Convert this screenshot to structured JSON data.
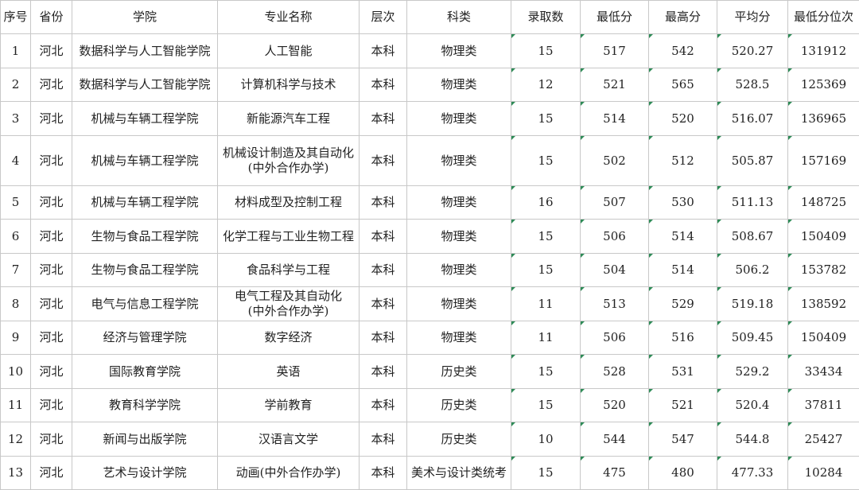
{
  "table": {
    "headers": [
      "序号",
      "省份",
      "学院",
      "专业名称",
      "层次",
      "科类",
      "录取数",
      "最低分",
      "最高分",
      "平均分",
      "最低分位次"
    ],
    "rows": [
      [
        "1",
        "河北",
        "数据科学与人工智能学院",
        "人工智能",
        "本科",
        "物理类",
        "15",
        "517",
        "542",
        "520.27",
        "131912"
      ],
      [
        "2",
        "河北",
        "数据科学与人工智能学院",
        "计算机科学与技术",
        "本科",
        "物理类",
        "12",
        "521",
        "565",
        "528.5",
        "125369"
      ],
      [
        "3",
        "河北",
        "机械与车辆工程学院",
        "新能源汽车工程",
        "本科",
        "物理类",
        "15",
        "514",
        "520",
        "516.07",
        "136965"
      ],
      [
        "4",
        "河北",
        "机械与车辆工程学院",
        "机械设计制造及其自动化\n(中外合作办学)",
        "本科",
        "物理类",
        "15",
        "502",
        "512",
        "505.87",
        "157169"
      ],
      [
        "5",
        "河北",
        "机械与车辆工程学院",
        "材料成型及控制工程",
        "本科",
        "物理类",
        "16",
        "507",
        "530",
        "511.13",
        "148725"
      ],
      [
        "6",
        "河北",
        "生物与食品工程学院",
        "化学工程与工业生物工程",
        "本科",
        "物理类",
        "15",
        "506",
        "514",
        "508.67",
        "150409"
      ],
      [
        "7",
        "河北",
        "生物与食品工程学院",
        "食品科学与工程",
        "本科",
        "物理类",
        "15",
        "504",
        "514",
        "506.2",
        "153782"
      ],
      [
        "8",
        "河北",
        "电气与信息工程学院",
        "电气工程及其自动化\n(中外合作办学)",
        "本科",
        "物理类",
        "11",
        "513",
        "529",
        "519.18",
        "138592"
      ],
      [
        "9",
        "河北",
        "经济与管理学院",
        "数字经济",
        "本科",
        "物理类",
        "11",
        "506",
        "516",
        "509.45",
        "150409"
      ],
      [
        "10",
        "河北",
        "国际教育学院",
        "英语",
        "本科",
        "历史类",
        "15",
        "528",
        "531",
        "529.2",
        "33434"
      ],
      [
        "11",
        "河北",
        "教育科学学院",
        "学前教育",
        "本科",
        "历史类",
        "15",
        "520",
        "521",
        "520.4",
        "37811"
      ],
      [
        "12",
        "河北",
        "新闻与出版学院",
        "汉语言文学",
        "本科",
        "历史类",
        "10",
        "544",
        "547",
        "544.8",
        "25427"
      ],
      [
        "13",
        "河北",
        "艺术与设计学院",
        "动画(中外合作办学)",
        "本科",
        "美术与设计类统考",
        "15",
        "475",
        "480",
        "477.33",
        "10284"
      ]
    ]
  },
  "colors": {
    "grid": "#c8c8c8",
    "marker": "#2e8b57",
    "text": "#222222"
  }
}
